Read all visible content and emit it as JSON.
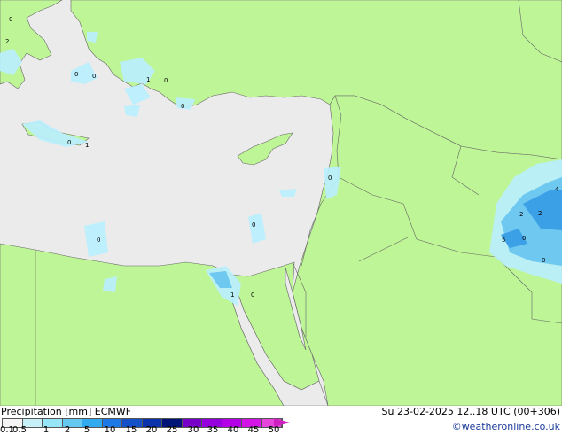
{
  "header": {
    "title": "Precipitation [mm]  ECMWF",
    "timestamp": "Su 23-02-2025 12..18 UTC (00+306)",
    "credit": "©weatheronline.co.uk"
  },
  "legend": {
    "ticks": [
      "0.1",
      "0.5",
      "1",
      "2",
      "5",
      "10",
      "15",
      "20",
      "25",
      "30",
      "35",
      "40",
      "45",
      "50"
    ],
    "colors": [
      "#f5f5f5",
      "#c8f0f8",
      "#96e6f8",
      "#64c8f0",
      "#32aaf0",
      "#1e78e6",
      "#1450c8",
      "#0a32aa",
      "#001478",
      "#7800c8",
      "#9600dc",
      "#b400e6",
      "#d214e6",
      "#e646dc"
    ]
  },
  "map": {
    "colors": {
      "sea": "#ebebeb",
      "land": "#bef596",
      "border": "#666666",
      "light_rain": "#b9efff",
      "rain": "#6ec8f0",
      "heavy_rain": "#3ca0e6"
    },
    "labels": [
      {
        "text": "0",
        "id": "l1"
      },
      {
        "text": "2",
        "id": "l2"
      },
      {
        "text": "0",
        "id": "l3"
      },
      {
        "text": "0",
        "id": "l4"
      },
      {
        "text": "1",
        "id": "l5"
      },
      {
        "text": "0",
        "id": "l6"
      },
      {
        "text": "0",
        "id": "l7"
      },
      {
        "text": "0",
        "id": "l8"
      },
      {
        "text": "1",
        "id": "l9"
      },
      {
        "text": "0",
        "id": "l10"
      },
      {
        "text": "0",
        "id": "l11"
      },
      {
        "text": "0",
        "id": "l12"
      },
      {
        "text": "1",
        "id": "l13"
      },
      {
        "text": "0",
        "id": "l14"
      },
      {
        "text": "4",
        "id": "l15"
      },
      {
        "text": "2",
        "id": "l16"
      },
      {
        "text": "2",
        "id": "l17"
      },
      {
        "text": "5",
        "id": "l18"
      },
      {
        "text": "0",
        "id": "l19"
      },
      {
        "text": "0",
        "id": "l20"
      }
    ]
  }
}
